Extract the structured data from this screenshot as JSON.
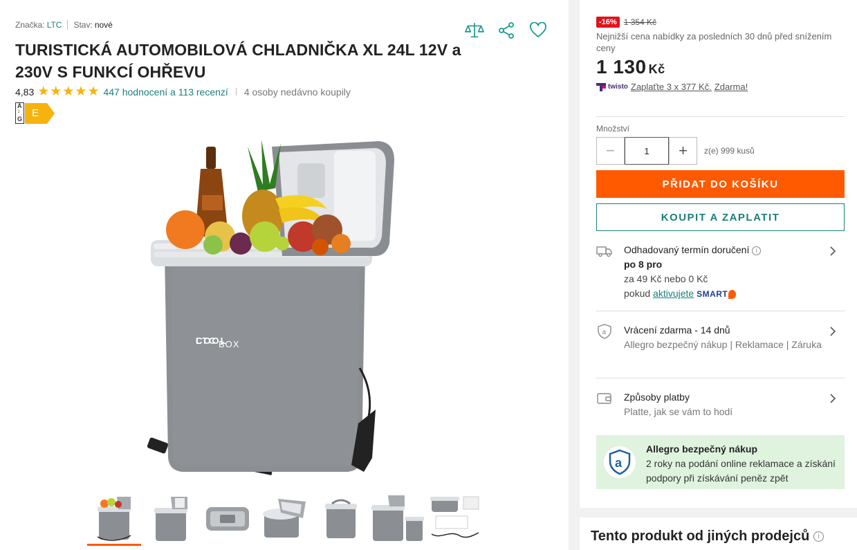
{
  "product": {
    "brand_label": "Značka:",
    "brand_value": "LTC",
    "condition_label": "Stav:",
    "condition_value": "nové",
    "title": "TURISTICKÁ AUTOMOBILOVÁ CHLADNIČKA XL 24L 12V a 230V S FUNKCÍ OHŘEVU",
    "rating": "4,83",
    "stars": 5,
    "reviews_link": "447 hodnocení a 113 recenzí",
    "recent_buyers": "4 osoby nedávno koupily",
    "energy_class": "E",
    "energy_scale_top": "A",
    "energy_scale_bottom": "G",
    "image_logo_text_1": "COOL",
    "image_logo_text_2": "BOX",
    "thumbnails": [
      "thumb-1",
      "thumb-2",
      "thumb-3",
      "thumb-4",
      "thumb-5",
      "thumb-6",
      "thumb-7"
    ]
  },
  "header_icons": [
    "compare-icon",
    "share-icon",
    "heart-icon"
  ],
  "pricing": {
    "discount_badge": "-16%",
    "old_price": "1 354 Kč",
    "lowest_note": "Nejnižší cena nabídky za posledních 30 dnů před snížením ceny",
    "price": "1 130",
    "currency": "Kč",
    "twisto_brand": "twisto",
    "twisto_link": "Zaplaťte 3 x 377 Kč.",
    "twisto_free": "Zdarma!"
  },
  "quantity": {
    "label": "Množství",
    "value": "1",
    "minus": "−",
    "plus": "+",
    "stock": "z(e) 999 kusů"
  },
  "actions": {
    "add_to_cart": "PŘIDAT DO KOŠÍKU",
    "buy_now": "KOUPIT A ZAPLATIT"
  },
  "delivery": {
    "title": "Odhadovaný termín doručení",
    "date": "po 8 pro",
    "cost": "za 49 Kč nebo 0 Kč",
    "smart_prefix": "pokud",
    "smart_link": "aktivujete",
    "smart_brand": "SMART"
  },
  "returns": {
    "title": "Vrácení zdarma - 14 dnů",
    "subtitle": "Allegro bezpečný nákup | Reklamace | Záruka"
  },
  "payment": {
    "title": "Způsoby platby",
    "subtitle": "Platte, jak se vám to hodí"
  },
  "safe_purchase": {
    "title": "Allegro bezpečný nákup",
    "text": "2 roky na podání online reklamace a získání podpory při získávání peněz zpět"
  },
  "other_sellers": {
    "title": "Tento produkt od jiných prodejců"
  },
  "colors": {
    "accent_orange": "#ff5a00",
    "accent_teal": "#1a7f7a",
    "discount_red": "#e3111b",
    "star_yellow": "#f6b30d",
    "safe_bg": "#dff3df"
  }
}
